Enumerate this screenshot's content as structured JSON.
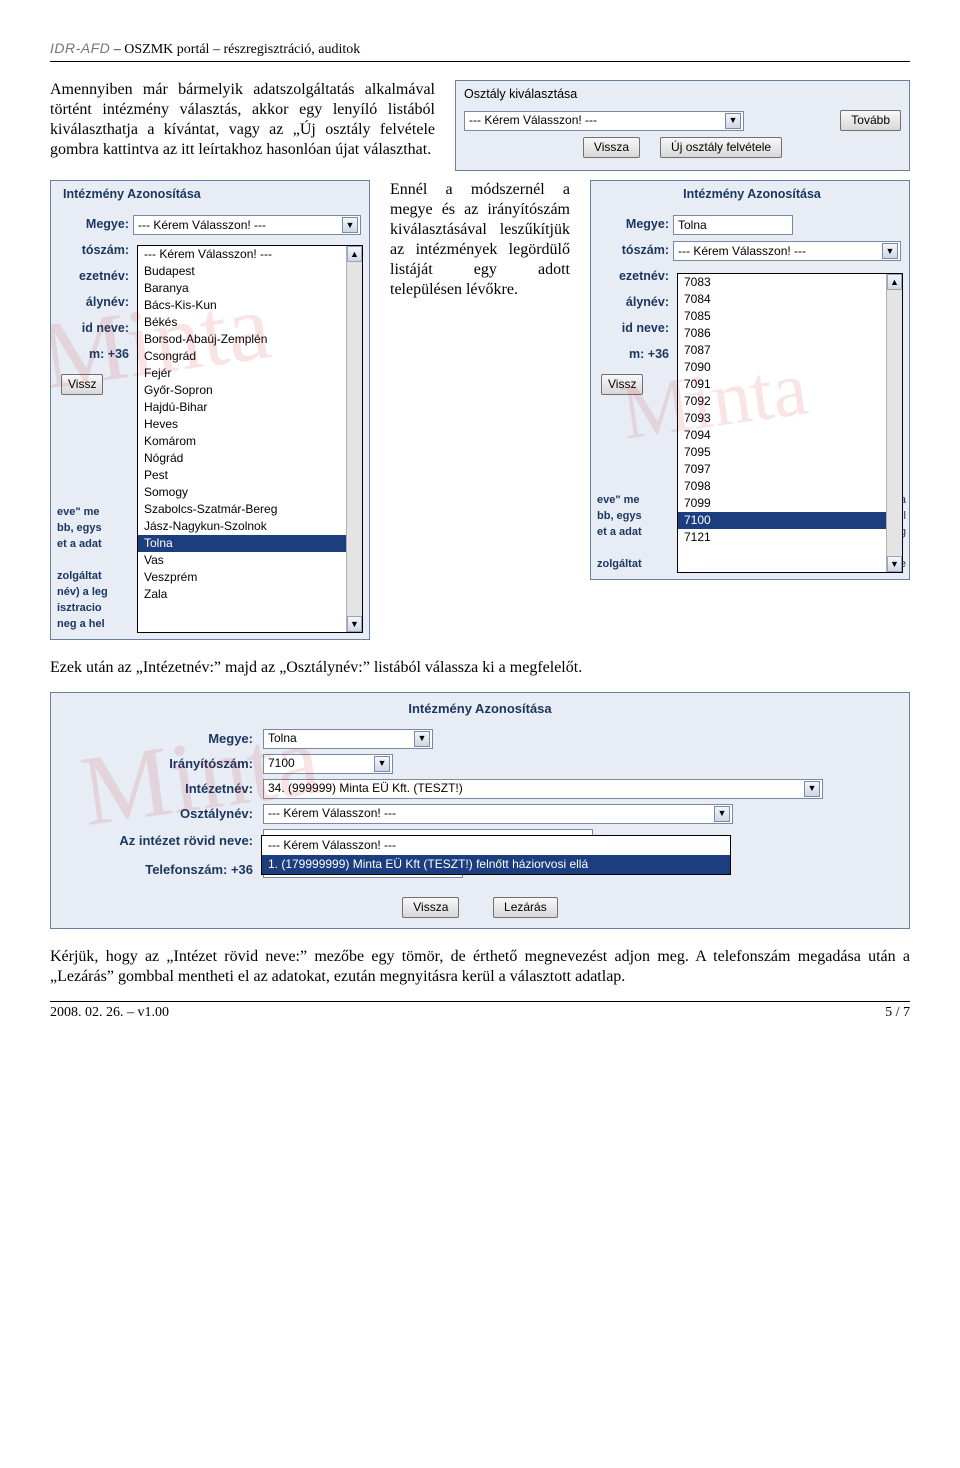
{
  "doc": {
    "header_idr": "IDR-AFD",
    "header_title": "– OSZMK portál – részregisztráció, auditok",
    "footer_left": "2008. 02. 26. – v1.00",
    "footer_right": "5 / 7"
  },
  "para1_html": "Amennyiben már bármelyik adatszolgáltatás alkalmával történt intézmény választás, akkor egy lenyíló listából kiválaszthatja a kívántat, vagy az „Új osztály felvétele gombra kattintva az itt leírtakhoz hasonlóan újat választhat.",
  "para2": "Ennél a módszernél a megye és az irányítószám kiválasztásával leszűkítjük az intézmények legördülő listáját egy adott településen lévőkre.",
  "para3": "Ezek után az „Intézetnév:” majd az „Osztálynév:” listából válassza ki a megfelelőt.",
  "para4": "Kérjük, hogy az „Intézet rövid neve:” mezőbe egy tömör, de érthető megnevezést adjon meg. A telefonszám megadása után a „Lezárás” gombbal mentheti el az adatokat, ezután megnyitásra kerül a választott adatlap.",
  "panel1": {
    "title": "Osztály kiválasztása",
    "select_value": "--- Kérem Válasszon! ---",
    "btn_next": "Tovább",
    "btn_back": "Vissza",
    "btn_new": "Új osztály felvétele"
  },
  "crop_labels": {
    "heading": "Intézmény Azonosítása",
    "megye": "Megye:",
    "toszam": "tószám:",
    "ezetnev": "ezetnév:",
    "alynev": "álynév:",
    "idneve": "id neve:",
    "m36": "m: +36",
    "vissz": "Vissz"
  },
  "cropL": {
    "megye_value": "--- Kérem Válasszon! ---",
    "list_top": "--- Kérem Válasszon! ---",
    "counties": [
      "Budapest",
      "Baranya",
      "Bács-Kis-Kun",
      "Békés",
      "Borsod-Abaúj-Zemplén",
      "Csongrád",
      "Fejér",
      "Győr-Sopron",
      "Hajdú-Bihar",
      "Heves",
      "Komárom",
      "Nógrád",
      "Pest",
      "Somogy",
      "Szabolcs-Szatmár-Bereg",
      "Jász-Nagykun-Szolnok",
      "Tolna",
      "Vas",
      "Veszprém",
      "Zala"
    ],
    "highlight_index": 16,
    "bg_lines": [
      "eve\" me",
      "bb, egys",
      "et a adat",
      "",
      "zolgáltat",
      "név) a leg",
      "isztracio",
      "neg a hel"
    ]
  },
  "cropR": {
    "megye_value": "Tolna",
    "toszam_value": "--- Kérem Válasszon! ---",
    "zipcodes": [
      "7083",
      "7084",
      "7085",
      "7086",
      "7087",
      "7090",
      "7091",
      "7092",
      "7093",
      "7094",
      "7095",
      "7097",
      "7098",
      "7099",
      "7100",
      "7121"
    ],
    "highlight_index": 14,
    "bg_left": [
      "eve\" me",
      "bb, egys",
      "et a adat",
      "",
      "zolgáltat"
    ],
    "bg_right": [
      "da",
      "él",
      "ég",
      "",
      "se"
    ]
  },
  "form3": {
    "heading": "Intézmény Azonosítása",
    "labels": {
      "megye": "Megye:",
      "irsz": "Irányítószám:",
      "intezet": "Intézetnév:",
      "osztaly": "Osztálynév:",
      "rovid": "Az intézet rövid neve:",
      "tel": "Telefonszám: +36"
    },
    "values": {
      "megye": "Tolna",
      "irsz": "7100",
      "intezet": "34. (999999) Minta EÜ Kft. (TESZT!)",
      "osztaly": "--- Kérem Válasszon! ---"
    },
    "osztaly_options": [
      "--- Kérem Válasszon! ---",
      "1. (179999999) Minta EÜ Kft (TESZT!) felnőtt háziorvosi ellá"
    ],
    "osztaly_highlight": 1,
    "btn_back": "Vissza",
    "btn_close": "Lezárás"
  },
  "watermark": "Minta"
}
